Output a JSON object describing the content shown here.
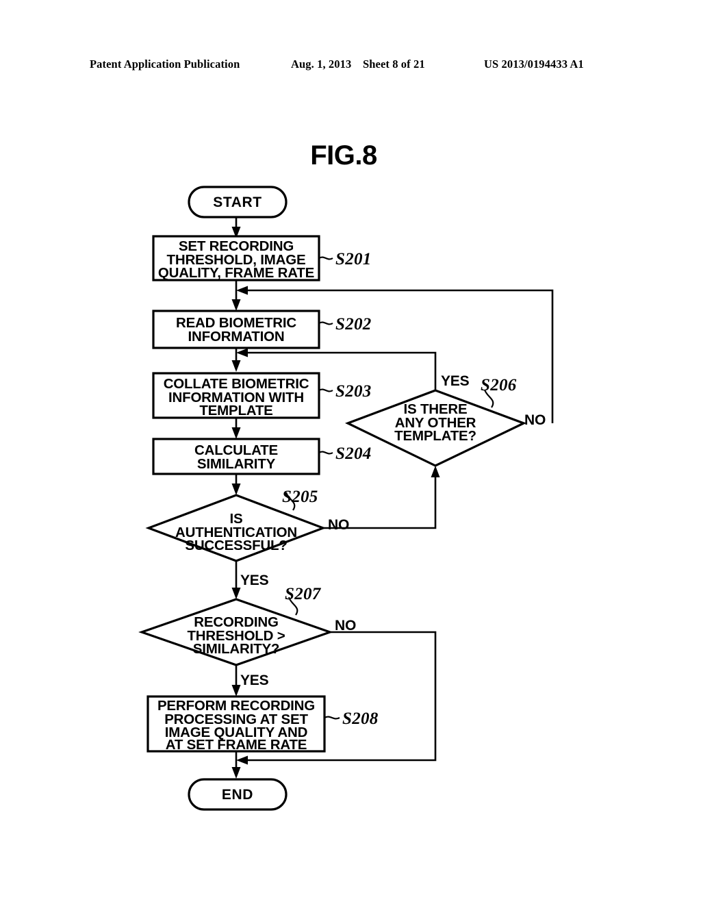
{
  "header": {
    "publication": "Patent Application Publication",
    "date": "Aug. 1, 2013",
    "sheet": "Sheet 8 of 21",
    "number": "US 2013/0194433 A1"
  },
  "figure": {
    "title": "FIG.8"
  },
  "flowchart": {
    "start_label": "START",
    "end_label": "END",
    "nodes": [
      {
        "id": "S201",
        "type": "process",
        "step": "S201",
        "lines": [
          "SET RECORDING",
          "THRESHOLD, IMAGE",
          "QUALITY, FRAME RATE"
        ]
      },
      {
        "id": "S202",
        "type": "process",
        "step": "S202",
        "lines": [
          "READ BIOMETRIC",
          "INFORMATION"
        ]
      },
      {
        "id": "S203",
        "type": "process",
        "step": "S203",
        "lines": [
          "COLLATE BIOMETRIC",
          "INFORMATION WITH",
          "TEMPLATE"
        ]
      },
      {
        "id": "S204",
        "type": "process",
        "step": "S204",
        "lines": [
          "CALCULATE",
          "SIMILARITY"
        ]
      },
      {
        "id": "S205",
        "type": "decision",
        "step": "S205",
        "lines": [
          "IS",
          "AUTHENTICATION",
          "SUCCESSFUL?"
        ],
        "yes_branch": "YES",
        "no_branch": "NO"
      },
      {
        "id": "S206",
        "type": "decision",
        "step": "S206",
        "lines": [
          "IS THERE",
          "ANY OTHER",
          "TEMPLATE?"
        ],
        "yes_branch": "YES",
        "no_branch": "NO"
      },
      {
        "id": "S207",
        "type": "decision",
        "step": "S207",
        "lines": [
          "RECORDING",
          "THRESHOLD >",
          "SIMILARITY?"
        ],
        "yes_branch": "YES",
        "no_branch": "NO"
      },
      {
        "id": "S208",
        "type": "process",
        "step": "S208",
        "lines": [
          "PERFORM RECORDING",
          "PROCESSING AT SET",
          "IMAGE QUALITY AND",
          "AT SET FRAME RATE"
        ]
      }
    ]
  }
}
